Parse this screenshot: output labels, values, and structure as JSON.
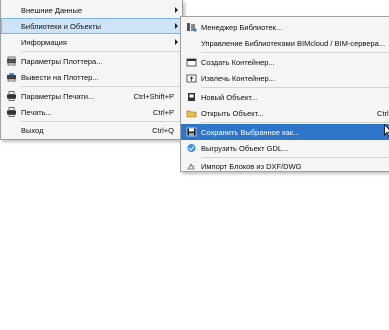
{
  "main_menu": {
    "items": [
      {
        "label": "Внешние Данные",
        "shortcut": ""
      },
      {
        "label": "Библиотеки и Объекты",
        "shortcut": ""
      },
      {
        "label": "Информация",
        "shortcut": ""
      },
      {
        "label": "Параметры Плоттера...",
        "shortcut": ""
      },
      {
        "label": "Вывести на Плоттер...",
        "shortcut": ""
      },
      {
        "label": "Параметры Печати...",
        "shortcut": "Ctrl+Shift+P"
      },
      {
        "label": "Печать...",
        "shortcut": "Ctrl+P"
      },
      {
        "label": "Выход",
        "shortcut": "Ctrl+Q"
      }
    ]
  },
  "sub_menu": {
    "items": [
      {
        "label": "Менеджер Библиотек...",
        "shortcut": ""
      },
      {
        "label": "Управление Библиотеками BIMcloud / BIM-сервера...",
        "shortcut": ""
      },
      {
        "label": "Создать Контейнер...",
        "shortcut": ""
      },
      {
        "label": "Извлечь Контейнер...",
        "shortcut": ""
      },
      {
        "label": "Новый Объект...",
        "shortcut": ""
      },
      {
        "label": "Открыть Объект...",
        "shortcut": "Ctrl+Shif"
      },
      {
        "label": "Сохранить Выбранное как...",
        "shortcut": ""
      },
      {
        "label": "Выгрузить Объект GDL...",
        "shortcut": ""
      },
      {
        "label": "Импорт Блоков из DXF/DWG",
        "shortcut": ""
      }
    ]
  },
  "colors": {
    "menu_bg": "#f5f5f5",
    "hover_bg": "#cde4f7",
    "selected_bg": "#2f76c9"
  }
}
